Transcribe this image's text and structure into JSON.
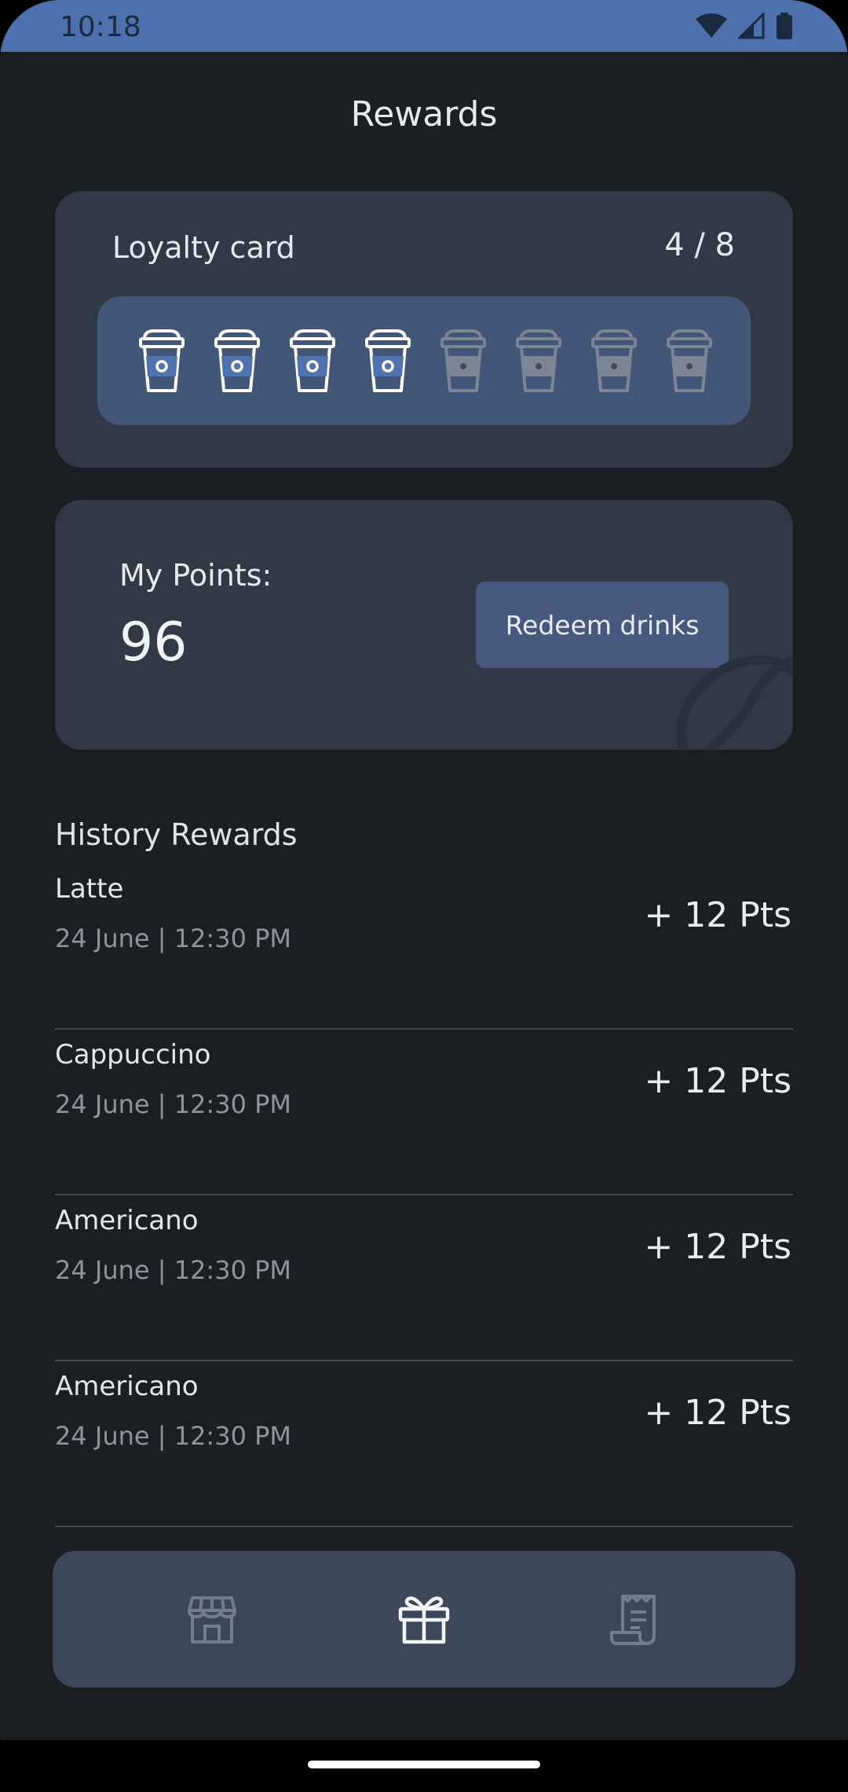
{
  "status_bar": {
    "time": "10:18",
    "icons": [
      "wifi-icon",
      "signal-icon",
      "battery-icon"
    ]
  },
  "header": {
    "title": "Rewards"
  },
  "loyalty": {
    "label": "Loyalty card",
    "count": "4 / 8",
    "filled": 4,
    "total": 8,
    "accent_color": "#4f72b0"
  },
  "points": {
    "label": "My Points:",
    "value": "96",
    "redeem_label": "Redeem drinks"
  },
  "history": {
    "title": "History Rewards",
    "items": [
      {
        "name": "Latte",
        "date": "24 June | 12:30 PM",
        "points": "+ 12 Pts"
      },
      {
        "name": "Cappuccino",
        "date": "24 June | 12:30 PM",
        "points": "+ 12 Pts"
      },
      {
        "name": "Americano",
        "date": "24 June | 12:30 PM",
        "points": "+ 12 Pts"
      },
      {
        "name": "Americano",
        "date": "24 June | 12:30 PM",
        "points": "+ 12 Pts"
      }
    ]
  },
  "nav": {
    "items": [
      {
        "icon": "store-icon",
        "active": false
      },
      {
        "icon": "gift-icon",
        "active": true
      },
      {
        "icon": "receipt-icon",
        "active": false
      }
    ]
  }
}
